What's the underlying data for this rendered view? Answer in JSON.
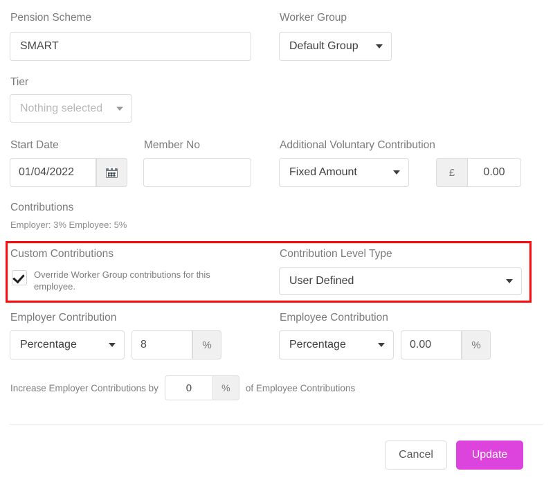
{
  "form": {
    "pension_scheme": {
      "label": "Pension Scheme",
      "value": "SMART"
    },
    "worker_group": {
      "label": "Worker Group",
      "value": "Default Group"
    },
    "tier": {
      "label": "Tier",
      "value": "Nothing selected"
    },
    "start_date": {
      "label": "Start Date",
      "value": "01/04/2022",
      "calendar_icon": "calendar-icon"
    },
    "member_no": {
      "label": "Member No",
      "value": "",
      "placeholder": ""
    },
    "avc": {
      "label": "Additional Voluntary Contribution",
      "type_value": "Fixed Amount",
      "currency_symbol": "£",
      "amount": "0.00"
    },
    "contributions": {
      "label": "Contributions",
      "summary": "Employer: 3% Employee: 5%"
    },
    "custom_contributions": {
      "label": "Custom Contributions",
      "checkbox_label": "Override Worker Group contributions for this employee.",
      "checked": true
    },
    "contribution_level_type": {
      "label": "Contribution Level Type",
      "value": "User Defined"
    },
    "employer_contribution": {
      "label": "Employer Contribution",
      "type_value": "Percentage",
      "amount": "8",
      "unit": "%"
    },
    "employee_contribution": {
      "label": "Employee Contribution",
      "type_value": "Percentage",
      "amount": "0.00",
      "unit": "%"
    },
    "increase_row": {
      "prefix": "Increase Employer Contributions by",
      "amount": "0",
      "unit": "%",
      "suffix": "of Employee Contributions"
    }
  },
  "footer": {
    "cancel_label": "Cancel",
    "update_label": "Update"
  },
  "colors": {
    "highlight_border": "#fb0d0d",
    "primary_button": "#dd44dd",
    "label_text": "#7a7a7a"
  }
}
